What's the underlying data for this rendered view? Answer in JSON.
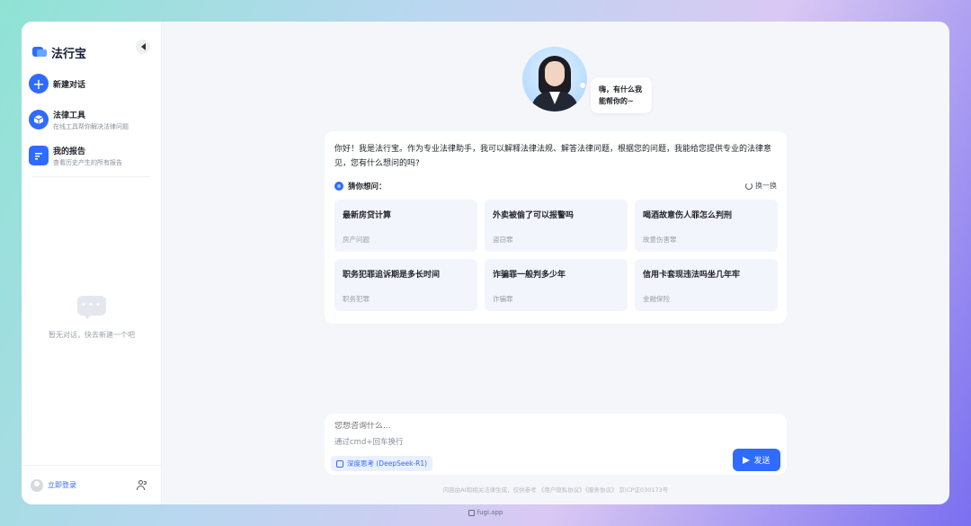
{
  "app": {
    "name": "法行宝"
  },
  "sidebar": {
    "new_chat": "新建对话",
    "items": [
      {
        "title": "法律工具",
        "subtitle": "在线工具帮你解决法律问题"
      },
      {
        "title": "我的报告",
        "subtitle": "查看历史产生的所有报告"
      }
    ],
    "empty_text": "暂无对话，快去新建一个吧",
    "login": "立即登录"
  },
  "hero": {
    "greeting_line1": "嗨，有什么我",
    "greeting_line2": "能帮你的~"
  },
  "welcome": {
    "text": "你好！我是法行宝。作为专业法律助手，我可以解释法律法规、解答法律问题，根据您的问题，我能给您提供专业的法律意见，您有什么想问的吗?",
    "guess_label": "猜你想问：",
    "refresh": "换一换",
    "questions": [
      {
        "title": "最新房贷计算",
        "tag": "房产问题"
      },
      {
        "title": "外卖被偷了可以报警吗",
        "tag": "盗窃罪"
      },
      {
        "title": "喝酒故意伤人罪怎么判刑",
        "tag": "故意伤害罪"
      },
      {
        "title": "职务犯罪追诉期是多长时间",
        "tag": "职务犯罪"
      },
      {
        "title": "诈骗罪一般判多少年",
        "tag": "诈骗罪"
      },
      {
        "title": "信用卡套现违法吗坐几年牢",
        "tag": "金融保险"
      }
    ]
  },
  "input": {
    "placeholder": "您想咨询什么...",
    "hint": "通过cmd+回车换行",
    "deep_think": "深度思考 (DeepSeek-R1)",
    "send": "发送"
  },
  "disclaimer": "内容由AI和相关法律生成，仅供参考 《用户隐私协议》《服务协议》 京ICP证030173号",
  "footer_label": "fugi.app",
  "colors": {
    "accent": "#2f6bff",
    "card_bg": "#f3f5fc"
  }
}
